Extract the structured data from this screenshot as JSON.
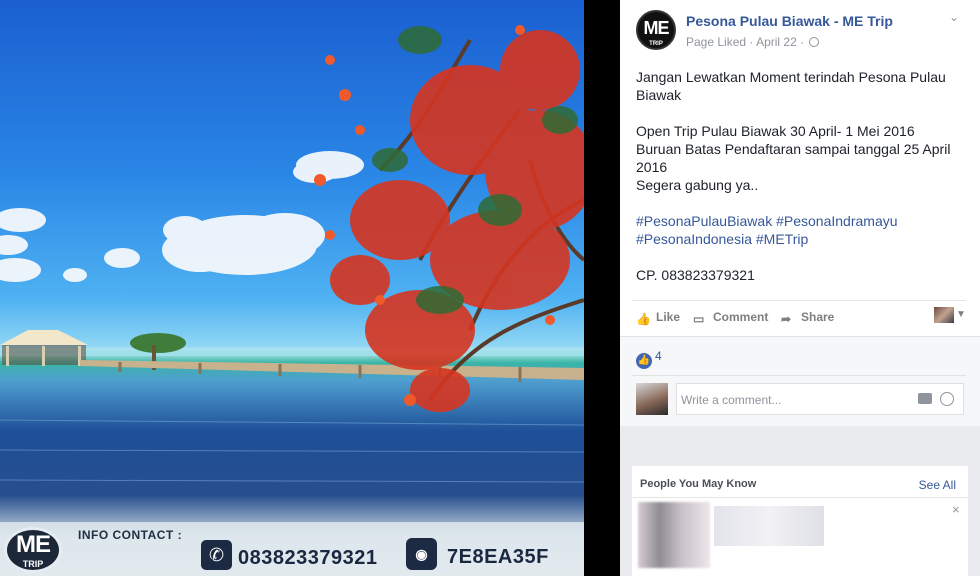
{
  "photo": {
    "banner": {
      "logo_text": "ME",
      "logo_subtext": "TRIP",
      "info_label": "INFO CONTACT :",
      "phone": "083823379321",
      "bbm_label": "BBM",
      "bbm_pin": "7E8EA35F"
    }
  },
  "post": {
    "page_name": "Pesona Pulau Biawak - ME Trip",
    "avatar_text": "ME",
    "avatar_subtext": "TRIP",
    "page_liked": "Page Liked",
    "separator": "·",
    "date": "April 22",
    "menu_icon": "chevron-down-icon",
    "body": {
      "line1": "Jangan Lewatkan Moment terindah Pesona Pulau Biawak",
      "line2": "Open Trip Pulau Biawak 30 April- 1 Mei 2016",
      "line3": "Buruan Batas Pendaftaran sampai tanggal 25 April 2016",
      "line4": "Segera gabung ya..",
      "hashtags": [
        "#PesonaPulauBiawak",
        "#PesonaIndramayu",
        "#PesonaIndonesia",
        "#METrip"
      ],
      "contact": "CP. 083823379321"
    }
  },
  "actions": {
    "like": "Like",
    "comment": "Comment",
    "share": "Share"
  },
  "reactions": {
    "count": "4"
  },
  "comment_box": {
    "placeholder": "Write a comment..."
  },
  "pymk": {
    "title": "People You May Know",
    "see_all": "See All",
    "dismiss": "×"
  },
  "colors": {
    "link": "#365899",
    "text": "#1d2129",
    "muted": "#90949c",
    "like_blue": "#4267b2"
  }
}
